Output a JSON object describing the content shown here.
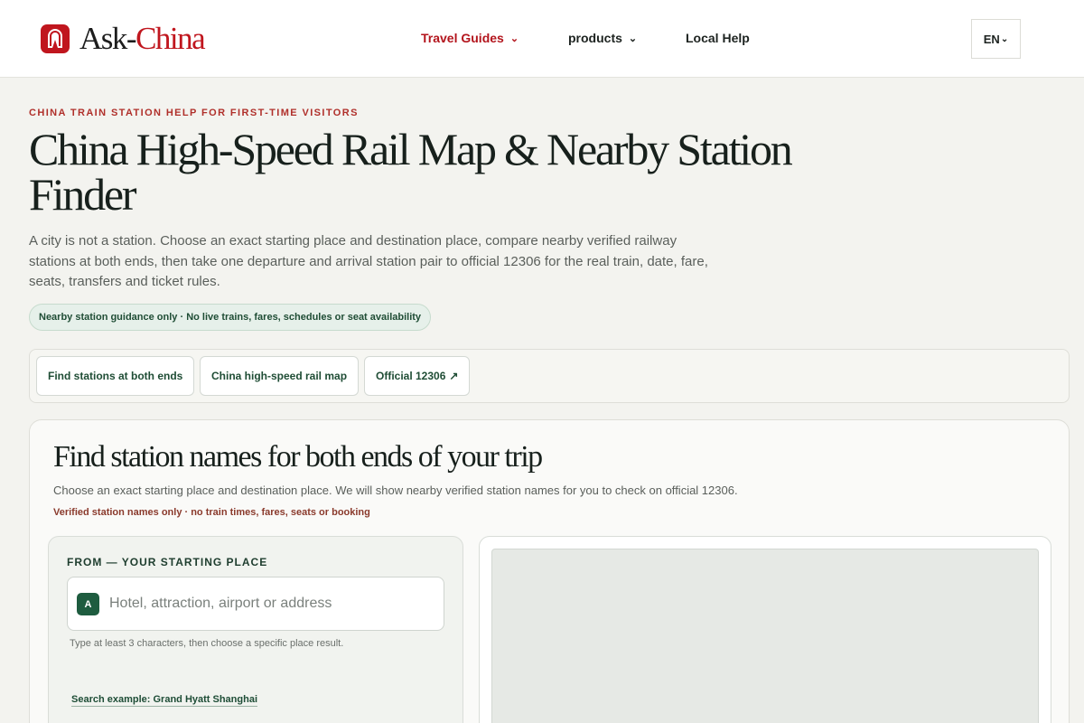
{
  "header": {
    "brand_prefix": "Ask-",
    "brand_accent": "China",
    "nav": [
      {
        "label": "Travel Guides",
        "has_dropdown": true,
        "active": true
      },
      {
        "label": "products",
        "has_dropdown": true,
        "active": false
      },
      {
        "label": "Local Help",
        "has_dropdown": false,
        "active": false
      }
    ],
    "language": "EN",
    "chevron": "⌄"
  },
  "hero": {
    "eyebrow": "CHINA TRAIN STATION HELP FOR FIRST-TIME VISITORS",
    "title": "China High-Speed Rail Map & Nearby Station Finder",
    "lede": "A city is not a station. Choose an exact starting place and destination place, compare nearby verified railway stations at both ends, then take one departure and arrival station pair to official 12306 for the real train, date, fare, seats, transfers and ticket rules.",
    "notice": "Nearby station guidance only · No live trains, fares, schedules or seat availability"
  },
  "tabs": [
    {
      "label": "Find stations at both ends"
    },
    {
      "label": "China high-speed rail map"
    },
    {
      "label": "Official 12306",
      "external_arrow": "↗"
    }
  ],
  "finder": {
    "title": "Find station names for both ends of your trip",
    "subtitle": "Choose an exact starting place and destination place. We will show nearby verified station names for you to check on official 12306.",
    "note": "Verified station names only · no train times, fares, seats or booking",
    "from": {
      "label": "FROM — YOUR STARTING PLACE",
      "badge": "A",
      "placeholder": "Hotel, attraction, airport or address",
      "value": "",
      "hint": "Type at least 3 characters, then choose a specific place result.",
      "example": "Search example: Grand Hyatt Shanghai"
    }
  },
  "colors": {
    "brand_red": "#c0161e",
    "accent_green": "#1e5c3f",
    "page_bg": "#f3f3ef"
  }
}
